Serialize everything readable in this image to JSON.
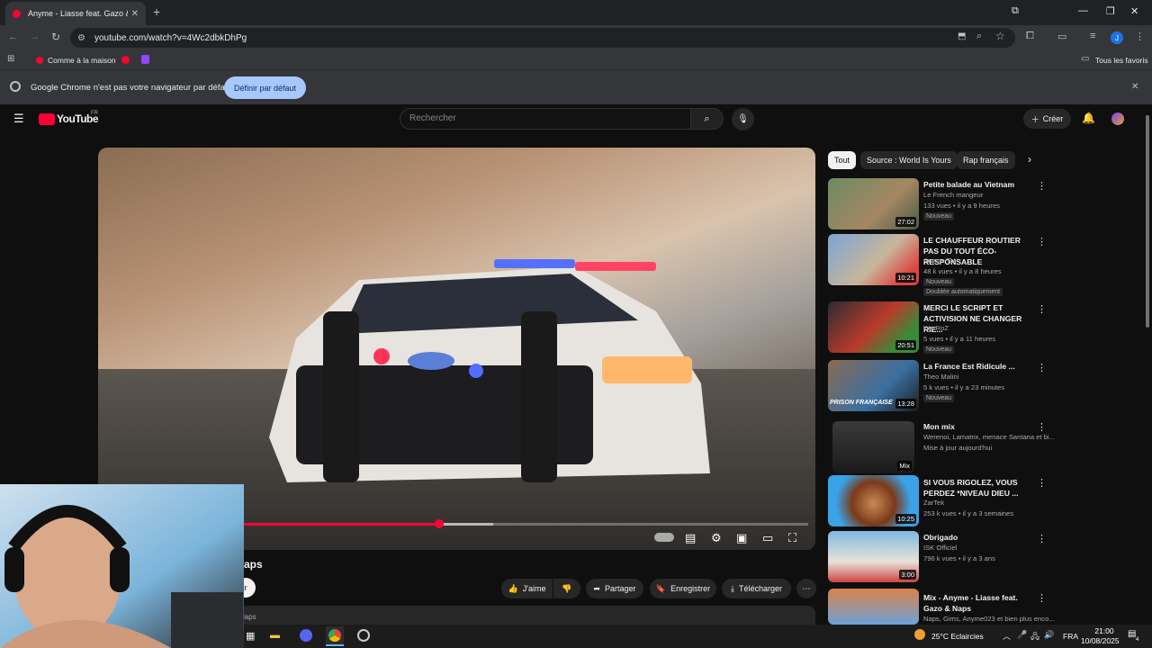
{
  "browser": {
    "tab_title": "Anyme - Liasse feat. Gazo &",
    "url": "youtube.com/watch?v=4Wc2dbkDhPg",
    "bookmarks": {
      "home": "Comme à la maison",
      "all_favorites": "Tous les favoris"
    },
    "infobar": {
      "message": "Google Chrome n'est pas votre navigateur par défaut",
      "button": "Définir par défaut"
    },
    "profile_initial": "J"
  },
  "youtube": {
    "logo": "YouTube",
    "region": "FR",
    "search_placeholder": "Rechercher",
    "create_label": "Créer",
    "title_fragment": "aps",
    "channel_fragment": "r",
    "desc_fragment": "laps",
    "actions": {
      "like": "J'aime",
      "share": "Partager",
      "save": "Enregistrer",
      "download": "Télécharger"
    },
    "chips": [
      "Tout",
      "Source : World Is Yours",
      "Rap français"
    ],
    "recommendations": [
      {
        "title": "Petite balade au Vietnam",
        "channel": "Le French mangeur",
        "meta": "133 vues • il y a 9 heures",
        "badge": "Nouveau",
        "duration": "27:02"
      },
      {
        "title": "LE CHAUFFEUR ROUTIER PAS DU TOUT ÉCO-RESPONSABLE",
        "channel": "Anyme TV",
        "meta": "48 k vues • il y a 8 heures",
        "badge": "Nouveau",
        "badge2": "Doublée automatiquement",
        "duration": "10:21"
      },
      {
        "title": "MERCI LE SCRIPT ET ACTIVISION NE CHANGER RIE...",
        "channel": "WarRoZ",
        "meta": "5 vues • il y a 11 heures",
        "badge": "Nouveau",
        "duration": "20:51"
      },
      {
        "title": "La France Est Ridicule ...",
        "channel": "Theo Malini",
        "meta": "5 k vues • il y a 23 minutes",
        "badge": "Nouveau",
        "duration": "13:28",
        "thumb_text": "PRISON FRANÇAISE"
      },
      {
        "title": "Mon mix",
        "channel": "Werenoi, Lamatrix, menace Santana et bi...",
        "meta": "Mise à jour aujourd'hui",
        "duration": "Mix"
      },
      {
        "title": "SI VOUS RIGOLEZ, VOUS PERDEZ *NIVEAU DIEU ...",
        "channel": "ZarTek",
        "meta": "253 k vues • il y a 3 semaines",
        "duration": "10:25"
      },
      {
        "title": "Obrigado",
        "channel": "ISK Officiel",
        "meta": "796 k vues • il y a 3 ans",
        "duration": "3:00"
      },
      {
        "title": "Mix - Anyme - Liasse feat. Gazo & Naps",
        "channel": "Naps, Gims, Anyme023 et bien plus enco..."
      }
    ]
  },
  "taskbar": {
    "weather": "25°C Eclaircies",
    "lang": "FRA",
    "time": "21:00",
    "date": "10/08/2025",
    "notif_count": "4"
  }
}
